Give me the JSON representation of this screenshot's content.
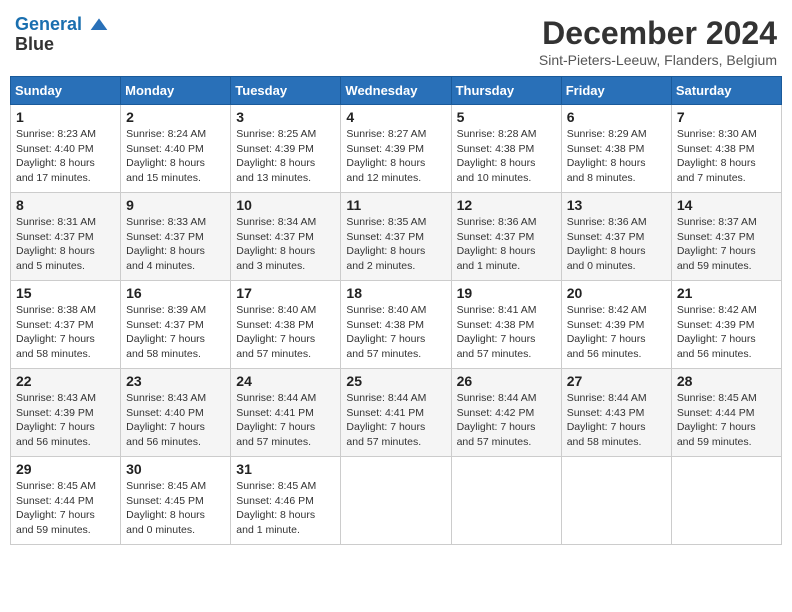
{
  "header": {
    "logo_line1": "General",
    "logo_line2": "Blue",
    "month_title": "December 2024",
    "location": "Sint-Pieters-Leeuw, Flanders, Belgium"
  },
  "days_of_week": [
    "Sunday",
    "Monday",
    "Tuesday",
    "Wednesday",
    "Thursday",
    "Friday",
    "Saturday"
  ],
  "weeks": [
    [
      {
        "day": 1,
        "sunrise": "8:23 AM",
        "sunset": "4:40 PM",
        "daylight": "8 hours and 17 minutes"
      },
      {
        "day": 2,
        "sunrise": "8:24 AM",
        "sunset": "4:40 PM",
        "daylight": "8 hours and 15 minutes"
      },
      {
        "day": 3,
        "sunrise": "8:25 AM",
        "sunset": "4:39 PM",
        "daylight": "8 hours and 13 minutes"
      },
      {
        "day": 4,
        "sunrise": "8:27 AM",
        "sunset": "4:39 PM",
        "daylight": "8 hours and 12 minutes"
      },
      {
        "day": 5,
        "sunrise": "8:28 AM",
        "sunset": "4:38 PM",
        "daylight": "8 hours and 10 minutes"
      },
      {
        "day": 6,
        "sunrise": "8:29 AM",
        "sunset": "4:38 PM",
        "daylight": "8 hours and 8 minutes"
      },
      {
        "day": 7,
        "sunrise": "8:30 AM",
        "sunset": "4:38 PM",
        "daylight": "8 hours and 7 minutes"
      }
    ],
    [
      {
        "day": 8,
        "sunrise": "8:31 AM",
        "sunset": "4:37 PM",
        "daylight": "8 hours and 5 minutes"
      },
      {
        "day": 9,
        "sunrise": "8:33 AM",
        "sunset": "4:37 PM",
        "daylight": "8 hours and 4 minutes"
      },
      {
        "day": 10,
        "sunrise": "8:34 AM",
        "sunset": "4:37 PM",
        "daylight": "8 hours and 3 minutes"
      },
      {
        "day": 11,
        "sunrise": "8:35 AM",
        "sunset": "4:37 PM",
        "daylight": "8 hours and 2 minutes"
      },
      {
        "day": 12,
        "sunrise": "8:36 AM",
        "sunset": "4:37 PM",
        "daylight": "8 hours and 1 minute"
      },
      {
        "day": 13,
        "sunrise": "8:36 AM",
        "sunset": "4:37 PM",
        "daylight": "8 hours and 0 minutes"
      },
      {
        "day": 14,
        "sunrise": "8:37 AM",
        "sunset": "4:37 PM",
        "daylight": "7 hours and 59 minutes"
      }
    ],
    [
      {
        "day": 15,
        "sunrise": "8:38 AM",
        "sunset": "4:37 PM",
        "daylight": "7 hours and 58 minutes"
      },
      {
        "day": 16,
        "sunrise": "8:39 AM",
        "sunset": "4:37 PM",
        "daylight": "7 hours and 58 minutes"
      },
      {
        "day": 17,
        "sunrise": "8:40 AM",
        "sunset": "4:38 PM",
        "daylight": "7 hours and 57 minutes"
      },
      {
        "day": 18,
        "sunrise": "8:40 AM",
        "sunset": "4:38 PM",
        "daylight": "7 hours and 57 minutes"
      },
      {
        "day": 19,
        "sunrise": "8:41 AM",
        "sunset": "4:38 PM",
        "daylight": "7 hours and 57 minutes"
      },
      {
        "day": 20,
        "sunrise": "8:42 AM",
        "sunset": "4:39 PM",
        "daylight": "7 hours and 56 minutes"
      },
      {
        "day": 21,
        "sunrise": "8:42 AM",
        "sunset": "4:39 PM",
        "daylight": "7 hours and 56 minutes"
      }
    ],
    [
      {
        "day": 22,
        "sunrise": "8:43 AM",
        "sunset": "4:39 PM",
        "daylight": "7 hours and 56 minutes"
      },
      {
        "day": 23,
        "sunrise": "8:43 AM",
        "sunset": "4:40 PM",
        "daylight": "7 hours and 56 minutes"
      },
      {
        "day": 24,
        "sunrise": "8:44 AM",
        "sunset": "4:41 PM",
        "daylight": "7 hours and 57 minutes"
      },
      {
        "day": 25,
        "sunrise": "8:44 AM",
        "sunset": "4:41 PM",
        "daylight": "7 hours and 57 minutes"
      },
      {
        "day": 26,
        "sunrise": "8:44 AM",
        "sunset": "4:42 PM",
        "daylight": "7 hours and 57 minutes"
      },
      {
        "day": 27,
        "sunrise": "8:44 AM",
        "sunset": "4:43 PM",
        "daylight": "7 hours and 58 minutes"
      },
      {
        "day": 28,
        "sunrise": "8:45 AM",
        "sunset": "4:44 PM",
        "daylight": "7 hours and 59 minutes"
      }
    ],
    [
      {
        "day": 29,
        "sunrise": "8:45 AM",
        "sunset": "4:44 PM",
        "daylight": "7 hours and 59 minutes"
      },
      {
        "day": 30,
        "sunrise": "8:45 AM",
        "sunset": "4:45 PM",
        "daylight": "8 hours and 0 minutes"
      },
      {
        "day": 31,
        "sunrise": "8:45 AM",
        "sunset": "4:46 PM",
        "daylight": "8 hours and 1 minute"
      },
      null,
      null,
      null,
      null
    ]
  ]
}
